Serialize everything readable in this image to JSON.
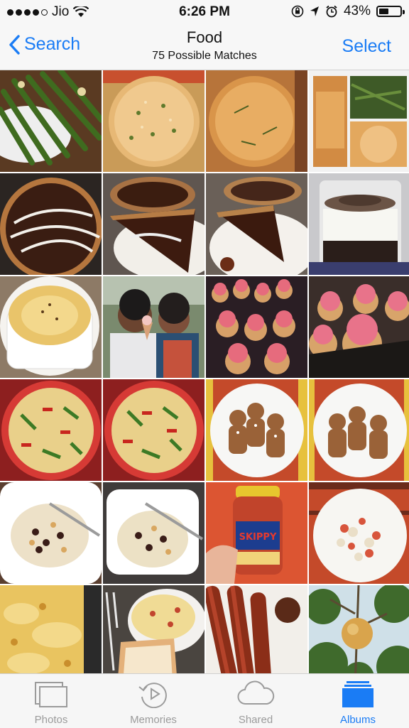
{
  "status": {
    "carrier": "Jio",
    "time": "6:26 PM",
    "battery": "43%"
  },
  "nav": {
    "back_label": "Search",
    "title": "Food",
    "subtitle": "75 Possible Matches",
    "select_label": "Select"
  },
  "tabs": [
    {
      "label": "Photos",
      "icon": "photos-icon",
      "active": false
    },
    {
      "label": "Memories",
      "icon": "memories-icon",
      "active": false
    },
    {
      "label": "Shared",
      "icon": "cloud-icon",
      "active": false
    },
    {
      "label": "Albums",
      "icon": "albums-icon",
      "active": true
    }
  ],
  "photos": [
    {
      "subject": "asparagus"
    },
    {
      "subject": "focaccia"
    },
    {
      "subject": "focaccia"
    },
    {
      "subject": "focaccia collage"
    },
    {
      "subject": "chocolate tart"
    },
    {
      "subject": "tart slice"
    },
    {
      "subject": "tart slice"
    },
    {
      "subject": "dessert jar"
    },
    {
      "subject": "souffle"
    },
    {
      "subject": "friends with ice cream"
    },
    {
      "subject": "cupcakes"
    },
    {
      "subject": "cupcakes"
    },
    {
      "subject": "pizza"
    },
    {
      "subject": "pizza"
    },
    {
      "subject": "gingerbread men"
    },
    {
      "subject": "gingerbread men"
    },
    {
      "subject": "porridge"
    },
    {
      "subject": "porridge"
    },
    {
      "subject": "peanut butter jar"
    },
    {
      "subject": "salad"
    },
    {
      "subject": "lasagna"
    },
    {
      "subject": "omelette and toast"
    },
    {
      "subject": "sausages"
    },
    {
      "subject": "fruit on tree"
    }
  ],
  "jar_label": "SKIPPY"
}
